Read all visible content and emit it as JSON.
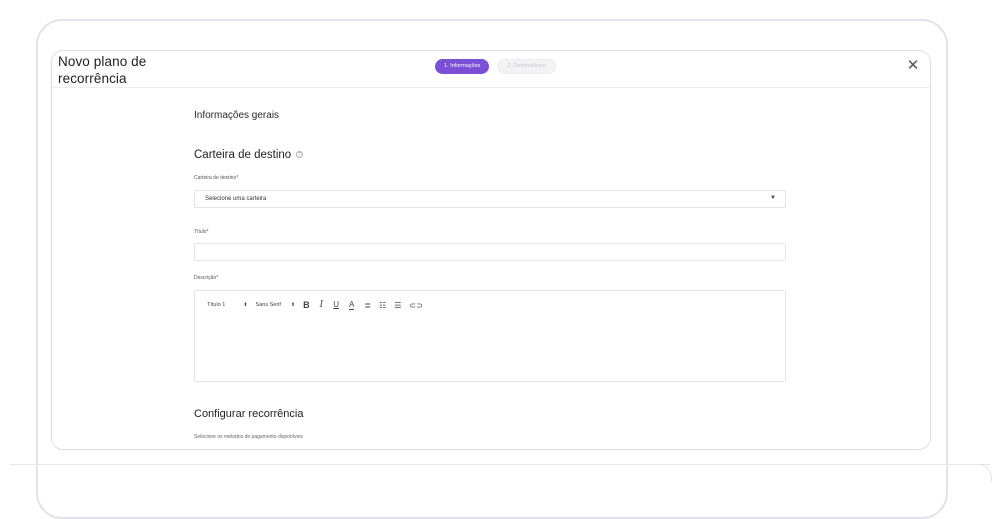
{
  "modal": {
    "title": "Novo plano de recorrência",
    "close_icon": "close-icon"
  },
  "stepper": {
    "steps": [
      {
        "label": "1. Informações",
        "state": "active"
      },
      {
        "label": "2. Destinatários",
        "state": "inactive"
      }
    ]
  },
  "general": {
    "heading": "Informações gerais"
  },
  "wallet": {
    "heading": "Carteira de destino",
    "field_label": "Carteira de destino*",
    "select_value": "Selecione uma carteira",
    "caret": "▼"
  },
  "title_field": {
    "label": "Título*",
    "value": ""
  },
  "description_field": {
    "label": "Descrição*",
    "toolbar": {
      "heading_select": "Título 1",
      "font_select": "Sans Serif"
    }
  },
  "recurrence": {
    "heading": "Configurar recorrência",
    "helper": "Selecione os métodos de pagamento disponíveis"
  },
  "colors": {
    "accent": "#7b4fd6",
    "border": "#e4e4ea"
  }
}
